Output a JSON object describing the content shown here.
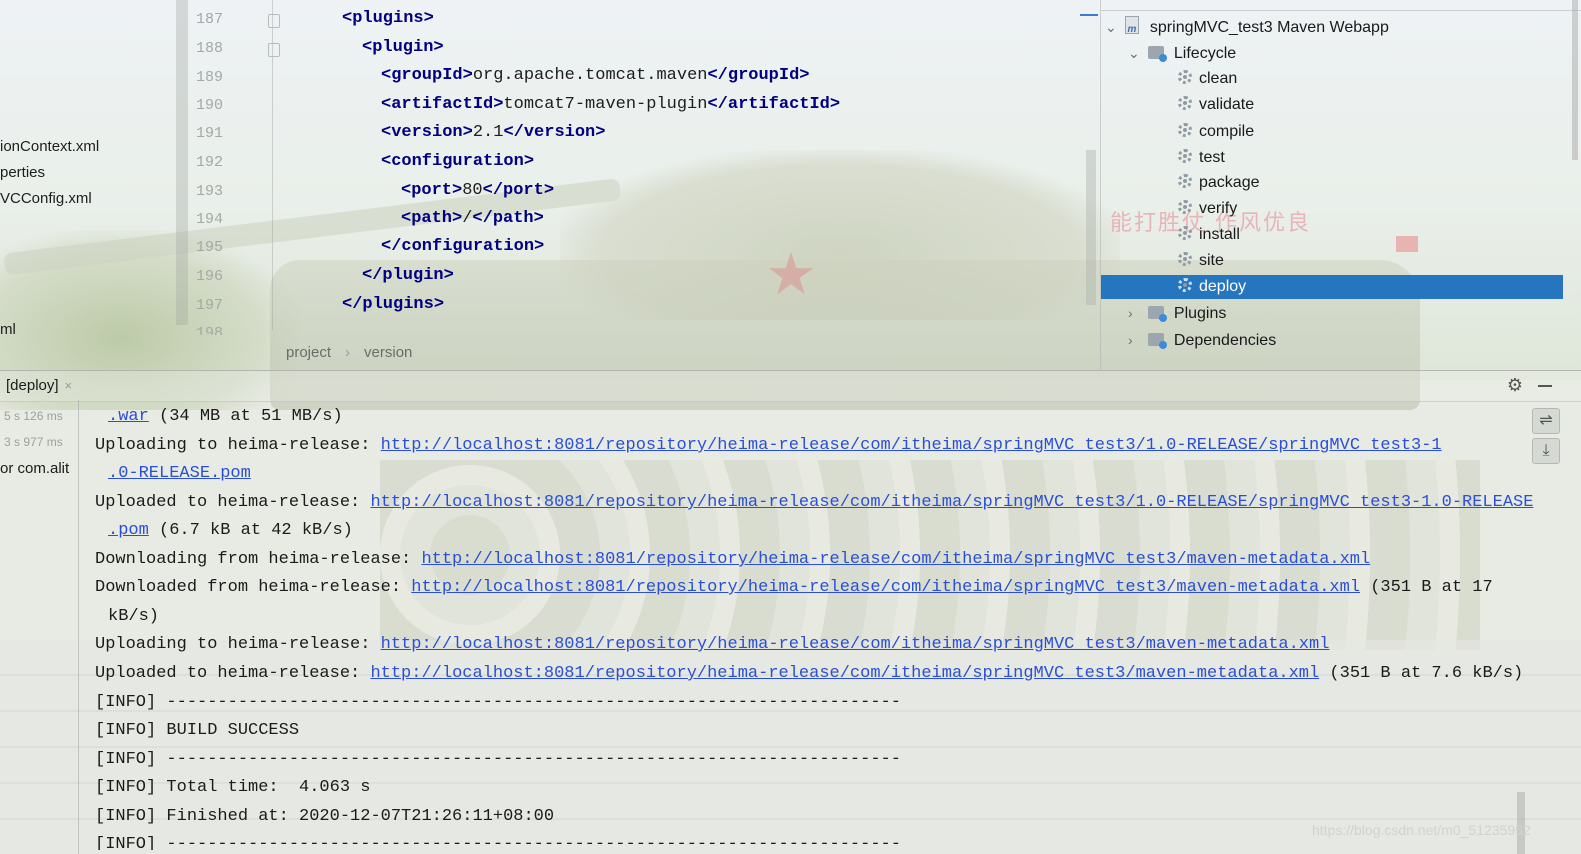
{
  "project_tree": {
    "items": [
      "ionContext.xml",
      "perties",
      "VCConfig.xml",
      "ml"
    ]
  },
  "editor": {
    "line_numbers": [
      "187",
      "188",
      "189",
      "190",
      "191",
      "192",
      "193",
      "194",
      "195",
      "196",
      "197",
      "198"
    ],
    "lines": [
      {
        "open": "<plugins>",
        "text": "",
        "close": ""
      },
      {
        "open": "<plugin>",
        "text": "",
        "close": ""
      },
      {
        "open": "<groupId>",
        "text": "org.apache.tomcat.maven",
        "close": "</groupId>"
      },
      {
        "open": "<artifactId>",
        "text": "tomcat7-maven-plugin",
        "close": "</artifactId>"
      },
      {
        "open": "<version>",
        "text": "2.1",
        "close": "</version>"
      },
      {
        "open": "<configuration>",
        "text": "",
        "close": ""
      },
      {
        "open": "<port>",
        "text": "80",
        "close": "</port>"
      },
      {
        "open": "<path>",
        "text": "/",
        "close": "</path>"
      },
      {
        "open": "</configuration>",
        "text": "",
        "close": ""
      },
      {
        "open": "</plugin>",
        "text": "",
        "close": ""
      },
      {
        "open": "</plugins>",
        "text": "",
        "close": ""
      }
    ],
    "breadcrumbs": [
      "project",
      "version"
    ],
    "breadcrumb_sep": "›"
  },
  "maven": {
    "project": "springMVC_test3 Maven Webapp",
    "lifecycle_label": "Lifecycle",
    "goals": [
      "clean",
      "validate",
      "compile",
      "test",
      "package",
      "verify",
      "install",
      "site",
      "deploy"
    ],
    "selected_goal": "deploy",
    "plugins_label": "Plugins",
    "dependencies_label": "Dependencies",
    "chevron_expanded": "⌄",
    "chevron_collapsed": "›"
  },
  "run": {
    "tab_label": "[deploy]",
    "tab_close": "×",
    "settings_glyph": "⚙",
    "task_times": [
      "5 s 126 ms",
      "3 s 977 ms"
    ],
    "task_label": "or com.alit",
    "tool_wrap": "⇌",
    "tool_scroll": "⤓",
    "console": [
      {
        "pre": "",
        "link": ".war",
        "post": " (34 MB at 51 MB/s)",
        "indent": true
      },
      {
        "pre": "Uploading to heima-release: ",
        "link": "http://localhost:8081/repository/heima-release/com/itheima/springMVC_test3/1.0-RELEASE/springMVC_test3-1",
        "post": "",
        "indent": false
      },
      {
        "pre": "",
        "link": ".0-RELEASE.pom",
        "post": "",
        "indent": true
      },
      {
        "pre": "Uploaded to heima-release: ",
        "link": "http://localhost:8081/repository/heima-release/com/itheima/springMVC_test3/1.0-RELEASE/springMVC_test3-1.0-RELEASE",
        "post": "",
        "indent": false
      },
      {
        "pre": "",
        "link": ".pom",
        "post": " (6.7 kB at 42 kB/s)",
        "indent": true
      },
      {
        "pre": "Downloading from heima-release: ",
        "link": "http://localhost:8081/repository/heima-release/com/itheima/springMVC_test3/maven-metadata.xml",
        "post": "",
        "indent": false
      },
      {
        "pre": "Downloaded from heima-release: ",
        "link": "http://localhost:8081/repository/heima-release/com/itheima/springMVC_test3/maven-metadata.xml",
        "post": " (351 B at 17",
        "indent": false
      },
      {
        "pre": "kB/s)",
        "link": "",
        "post": "",
        "indent": true
      },
      {
        "pre": "Uploading to heima-release: ",
        "link": "http://localhost:8081/repository/heima-release/com/itheima/springMVC_test3/maven-metadata.xml",
        "post": "",
        "indent": false
      },
      {
        "pre": "Uploaded to heima-release: ",
        "link": "http://localhost:8081/repository/heima-release/com/itheima/springMVC_test3/maven-metadata.xml",
        "post": " (351 B at 7.6 kB/s)",
        "indent": false
      },
      {
        "pre": "[INFO] ------------------------------------------------------------------------",
        "link": "",
        "post": "",
        "indent": false
      },
      {
        "pre": "[INFO] BUILD SUCCESS",
        "link": "",
        "post": "",
        "indent": false
      },
      {
        "pre": "[INFO] ------------------------------------------------------------------------",
        "link": "",
        "post": "",
        "indent": false
      },
      {
        "pre": "[INFO] Total time:  4.063 s",
        "link": "",
        "post": "",
        "indent": false
      },
      {
        "pre": "[INFO] Finished at: 2020-12-07T21:26:11+08:00",
        "link": "",
        "post": "",
        "indent": false
      },
      {
        "pre": "[INFO] ------------------------------------------------------------------------",
        "link": "",
        "post": "",
        "indent": false
      }
    ]
  },
  "background": {
    "slogan": "能打胜仗 作风优良",
    "star_glyph": "★",
    "watermark": "https://blog.csdn.net/m0_51235952"
  },
  "colors": {
    "selection": "#2675bf",
    "link": "#2a4fd6",
    "xml_tag": "#000080"
  }
}
